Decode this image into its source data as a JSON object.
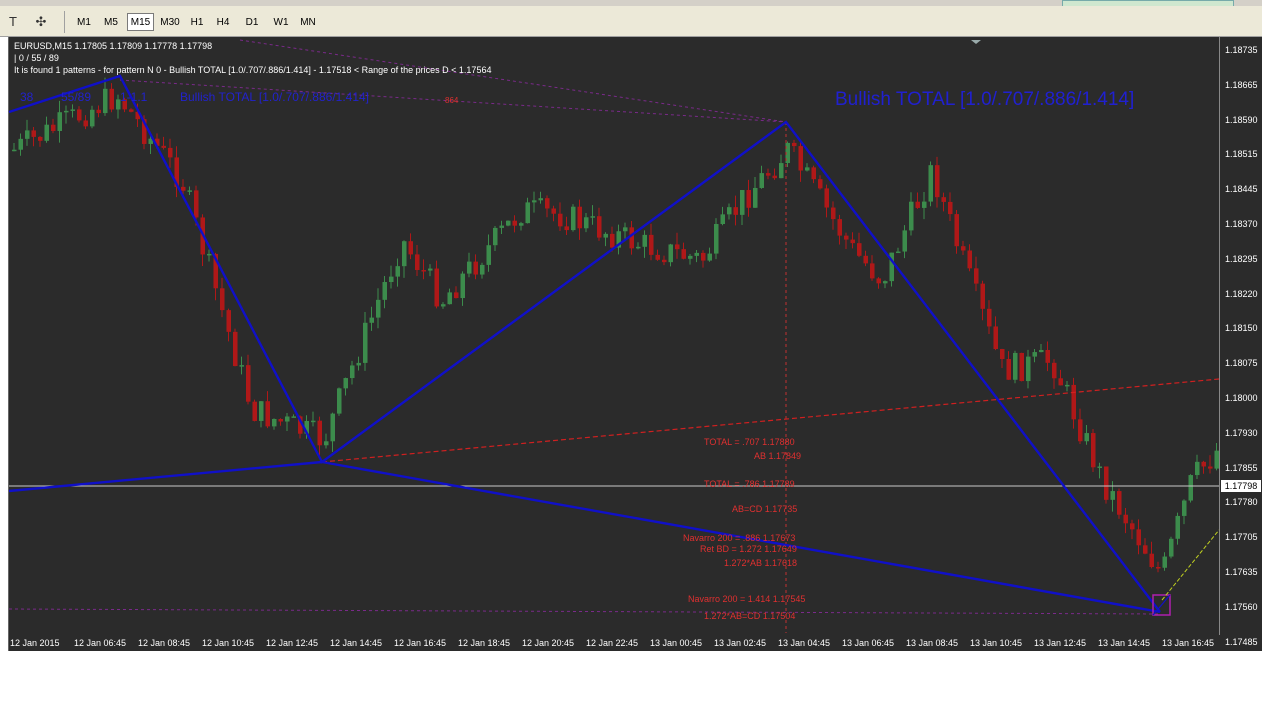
{
  "toolbar": {
    "timeframes": [
      "M1",
      "M5",
      "M15",
      "M30",
      "H1",
      "H4",
      "D1",
      "W1",
      "MN"
    ],
    "active_timeframe": "M15"
  },
  "chart": {
    "symbol_line": "EURUSD,M15  1.17805 1.17809 1.17778 1.17798",
    "counter_line": "| 0 / 55 / 89",
    "pattern_line": "It is found 1 patterns  -  for pattern N 0 - Bullish TOTAL [1.0/.707/.886/1.414] - 1.17518 < Range of the prices D < 1.17564",
    "current_price": "1.17798",
    "top_left_labels": {
      "fib_38": "38",
      "fib_55_89": "55/89",
      "ratio": "1-1.1",
      "pattern_small": "Bullish TOTAL [1.0/.707/.886/1.414]"
    },
    "mini_label": "864",
    "pattern_title": "Bullish TOTAL [1.0/.707/.886/1.414]",
    "red_labels": [
      "TOTAL = .707  1.17880",
      "AB  1.17849",
      "TOTAL = .786  1.17789",
      "AB=CD  1.17735",
      "Navarro 200 = .886  1.17673",
      "Ret BD = 1.272  1.17649",
      "1.272*AB  1.17618",
      "Navarro 200 = 1.414  1.17545",
      "1.272*AB=CD  1.17504"
    ]
  },
  "price_axis": [
    "1.18735",
    "1.18665",
    "1.18590",
    "1.18515",
    "1.18445",
    "1.18370",
    "1.18295",
    "1.18220",
    "1.18150",
    "1.18075",
    "1.18000",
    "1.17930",
    "1.17855",
    "1.17780",
    "1.17705",
    "1.17635",
    "1.17560",
    "1.17485"
  ],
  "time_axis": [
    "12 Jan 2015",
    "12 Jan 06:45",
    "12 Jan 08:45",
    "12 Jan 10:45",
    "12 Jan 12:45",
    "12 Jan 14:45",
    "12 Jan 16:45",
    "12 Jan 18:45",
    "12 Jan 20:45",
    "12 Jan 22:45",
    "13 Jan 00:45",
    "13 Jan 02:45",
    "13 Jan 04:45",
    "13 Jan 06:45",
    "13 Jan 08:45",
    "13 Jan 10:45",
    "13 Jan 12:45",
    "13 Jan 14:45",
    "13 Jan 16:45"
  ],
  "colors": {
    "background": "#2b2b2b",
    "bull": "#3c8c4c",
    "bear": "#b01818",
    "pattern": "#1010c8",
    "red_line": "#d02020"
  }
}
